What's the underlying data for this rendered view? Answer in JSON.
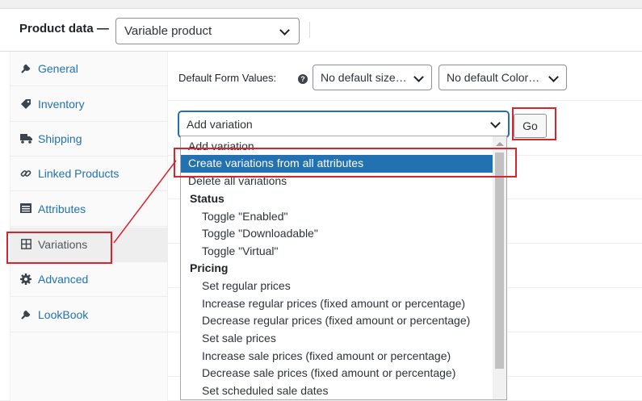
{
  "header": {
    "title": "Product data —",
    "product_type": "Variable product"
  },
  "sidebar": {
    "items": [
      {
        "label": "General",
        "icon": "wrench-icon"
      },
      {
        "label": "Inventory",
        "icon": "tag-icon"
      },
      {
        "label": "Shipping",
        "icon": "truck-icon"
      },
      {
        "label": "Linked Products",
        "icon": "link-icon"
      },
      {
        "label": "Attributes",
        "icon": "list-icon"
      },
      {
        "label": "Variations",
        "icon": "grid-icon"
      },
      {
        "label": "Advanced",
        "icon": "gear-icon"
      },
      {
        "label": "LookBook",
        "icon": "wrench-icon"
      }
    ]
  },
  "main": {
    "default_form_values_label": "Default Form Values:",
    "help_glyph": "?",
    "size_select": "No default size…",
    "color_select": "No default Color…",
    "variation_select": "Add variation",
    "go_button": "Go"
  },
  "dropdown": {
    "top_options": [
      "Add variation",
      "Create variations from all attributes",
      "Delete all variations"
    ],
    "groups": [
      {
        "label": "Status",
        "options": [
          "Toggle \"Enabled\"",
          "Toggle \"Downloadable\"",
          "Toggle \"Virtual\""
        ]
      },
      {
        "label": "Pricing",
        "options": [
          "Set regular prices",
          "Increase regular prices (fixed amount or percentage)",
          "Decrease regular prices (fixed amount or percentage)",
          "Set sale prices",
          "Increase sale prices (fixed amount or percentage)",
          "Decrease sale prices (fixed amount or percentage)",
          "Set scheduled sale dates"
        ]
      }
    ]
  },
  "colors": {
    "accent": "#2271b1",
    "highlight_box": "#d9232d"
  }
}
